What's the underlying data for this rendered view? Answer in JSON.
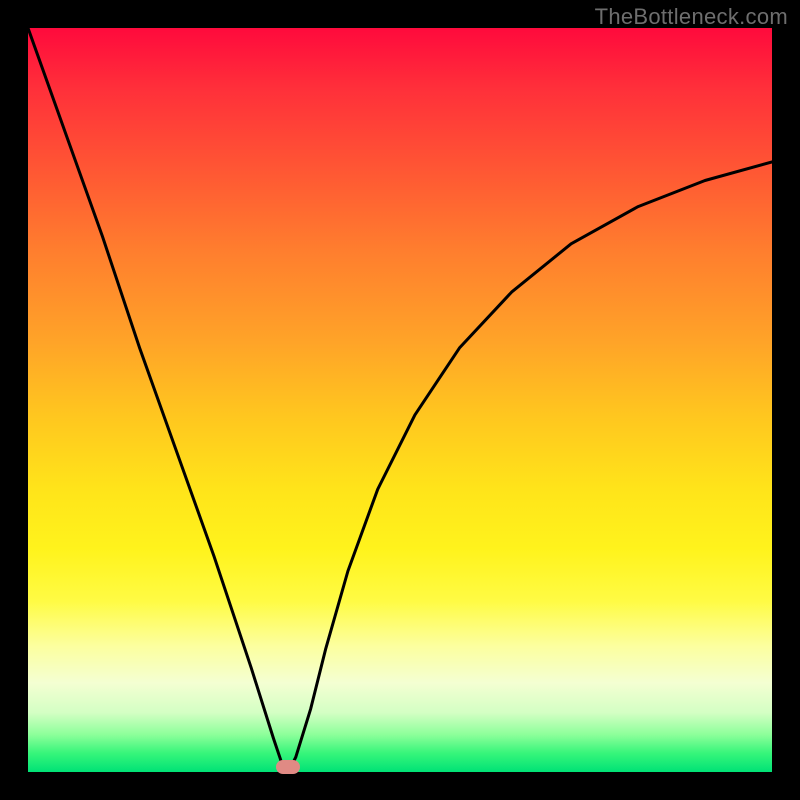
{
  "watermark": "TheBottleneck.com",
  "chart_data": {
    "type": "line",
    "title": "",
    "xlabel": "",
    "ylabel": "",
    "xlim": [
      0,
      1
    ],
    "ylim": [
      0,
      1
    ],
    "series": [
      {
        "name": "curve",
        "x": [
          0.0,
          0.05,
          0.1,
          0.15,
          0.2,
          0.25,
          0.3,
          0.33,
          0.34,
          0.35,
          0.36,
          0.38,
          0.4,
          0.43,
          0.47,
          0.52,
          0.58,
          0.65,
          0.73,
          0.82,
          0.91,
          1.0
        ],
        "values": [
          1.0,
          0.86,
          0.72,
          0.57,
          0.43,
          0.29,
          0.14,
          0.045,
          0.015,
          0.0,
          0.02,
          0.085,
          0.165,
          0.27,
          0.38,
          0.48,
          0.57,
          0.645,
          0.71,
          0.76,
          0.795,
          0.82
        ]
      }
    ],
    "marker": {
      "x": 0.35,
      "y": 0.0
    },
    "gradient_axis": "y (background)",
    "gradient_meaning": "red=high bottleneck, green=low bottleneck"
  }
}
